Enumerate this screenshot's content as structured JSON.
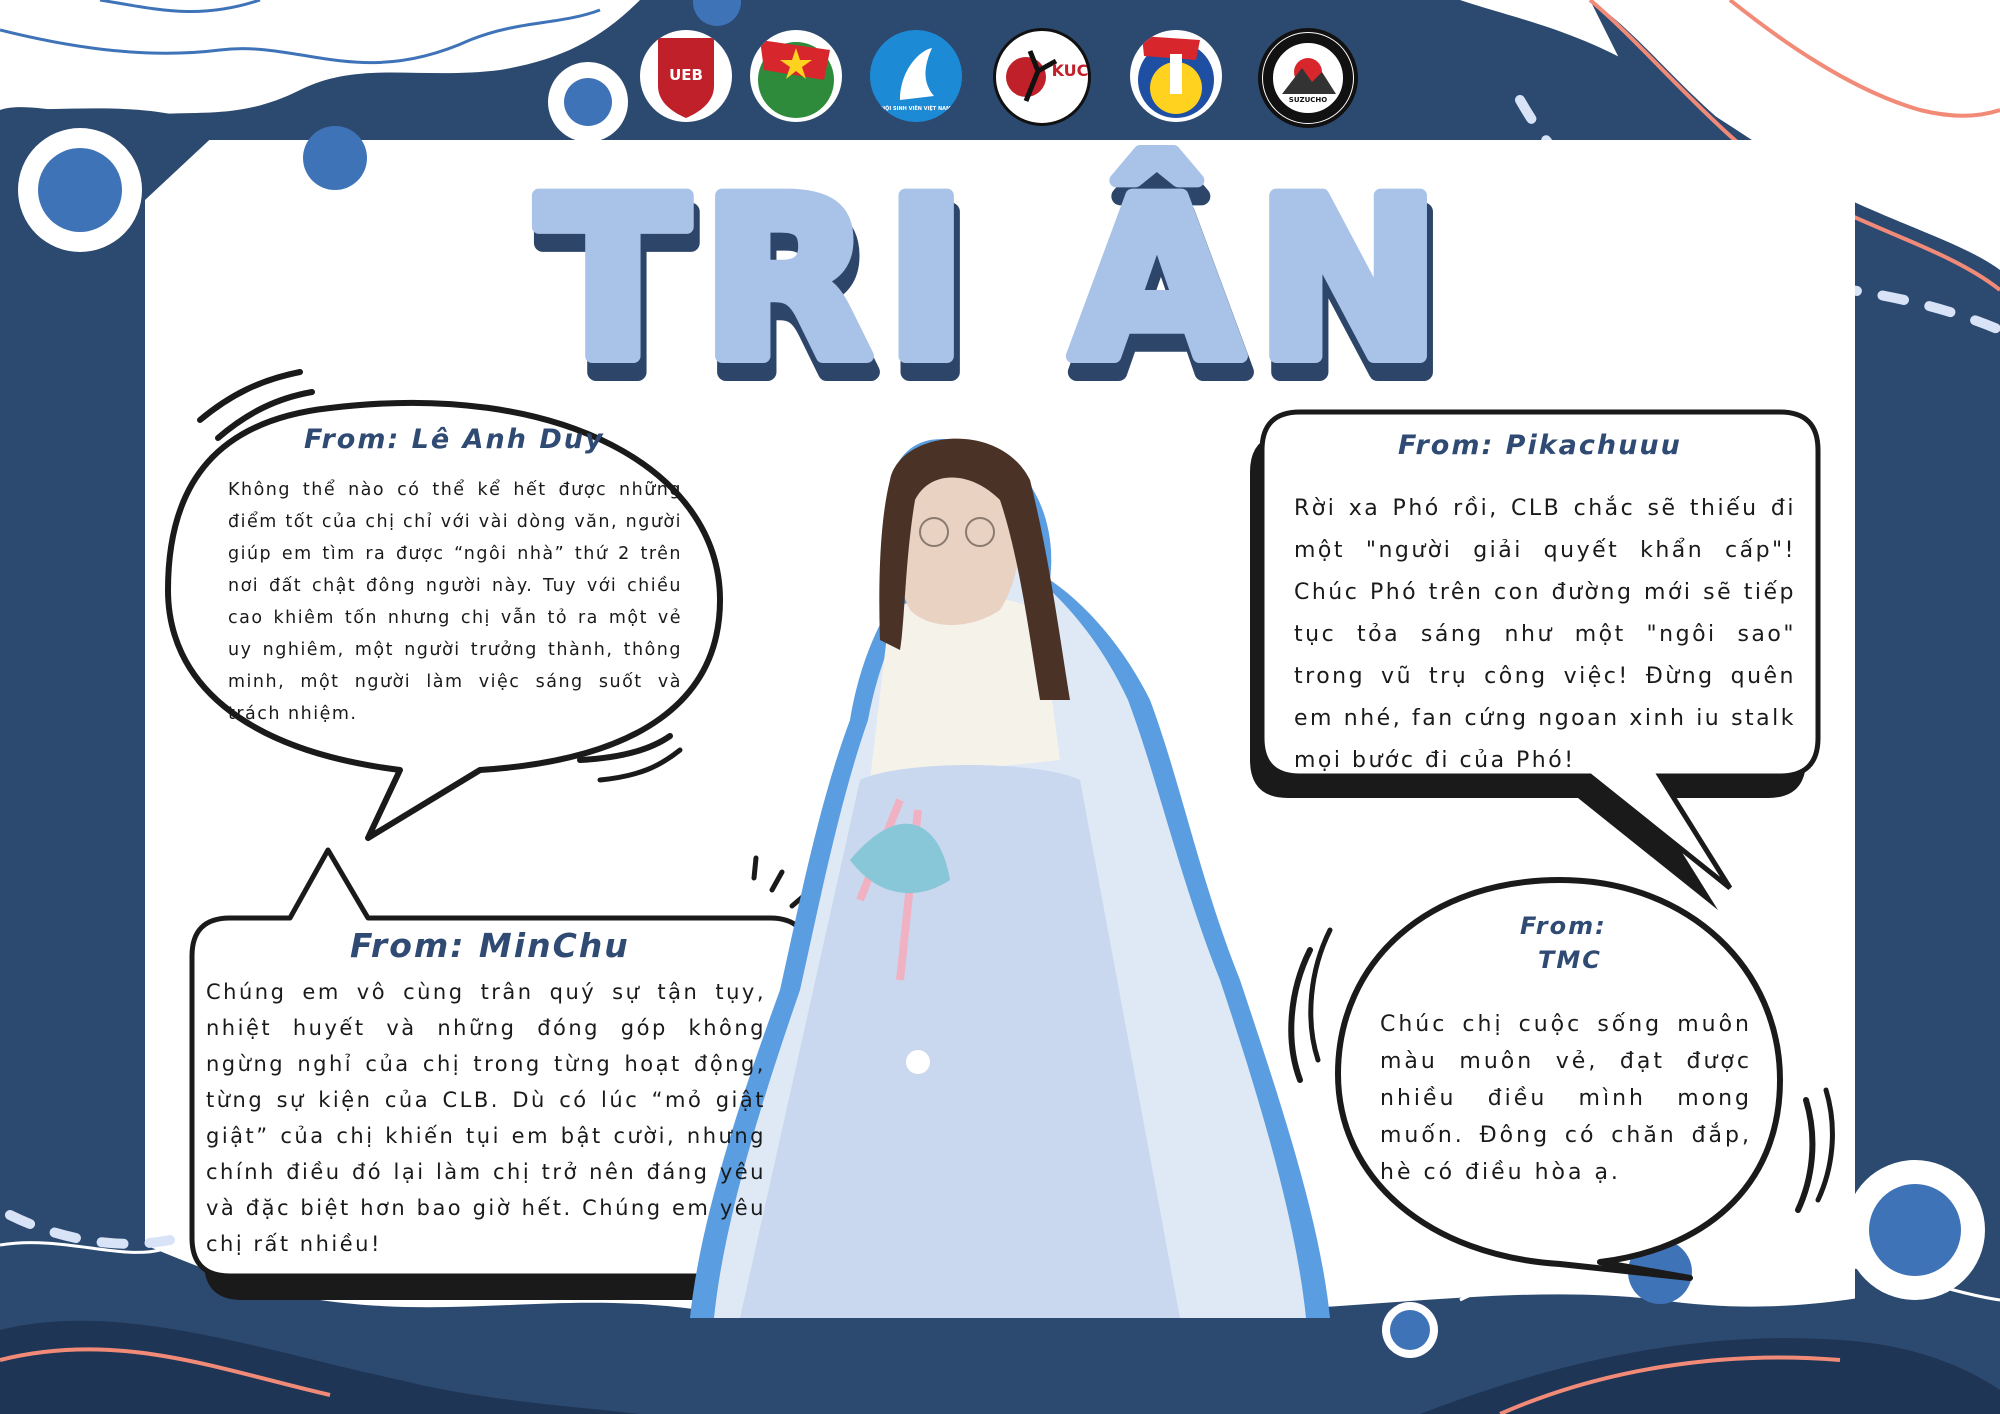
{
  "title": "TRI ÂN",
  "logos": [
    {
      "name": "ueb-logo",
      "text": "UEB"
    },
    {
      "name": "youth-union-logo",
      "text": ""
    },
    {
      "name": "student-association-logo",
      "text": "HỘI SINH VIÊN VIỆT NAM"
    },
    {
      "name": "karate-club-logo",
      "text": "KUC"
    },
    {
      "name": "karate-development-logo",
      "text": ""
    },
    {
      "name": "suzucho-logo",
      "text": "SUZUCHO"
    }
  ],
  "messages": [
    {
      "from": "From: Lê Anh Duy",
      "text": "Không thể nào có thể kể hết được những điểm tốt của chị chỉ với vài dòng văn, người giúp em tìm ra được “ngôi nhà” thứ 2 trên nơi đất chật đông người này. Tuy với chiều cao khiêm tốn nhưng chị vẫn tỏ ra một vẻ uy nghiêm, một người trưởng thành, thông minh, một người làm việc sáng suốt và trách nhiệm."
    },
    {
      "from": "From: Pikachuuu",
      "text": "Rời xa Phó rồi, CLB chắc sẽ thiếu đi một \"người giải quyết khẩn cấp\"! Chúc Phó trên con đường mới sẽ tiếp tục tỏa sáng như một \"ngôi sao\" trong vũ trụ công việc! Đừng quên em nhé, fan cứng ngoan xinh iu stalk mọi bước đi của Phó!"
    },
    {
      "from": "From: MinChu",
      "text": "Chúng em vô cùng trân quý sự tận tụy, nhiệt huyết và những đóng góp không ngừng nghỉ của chị trong từng hoạt động, từng sự kiện của CLB. Dù có lúc “mỏ giật giật” của chị khiến tụi em bật cười, nhưng chính điều đó lại làm chị trở nên đáng yêu và đặc biệt hơn bao giờ hết. Chúng em yêu chị rất nhiều!"
    },
    {
      "from_line1": "From:",
      "from_line2": "TMC",
      "text": "Chúc chị cuộc sống muôn màu muôn vẻ, đạt được nhiều điều mình mong muốn. Đông có chăn đắp, hè có điều hòa ạ."
    }
  ],
  "colors": {
    "navy": "#2c4a70",
    "blue": "#3f73b8",
    "light_blue": "#a9c3e6",
    "salmon": "#f28a78",
    "title_fill": "#a8c2e8",
    "title_shadow": "#2d4569"
  }
}
